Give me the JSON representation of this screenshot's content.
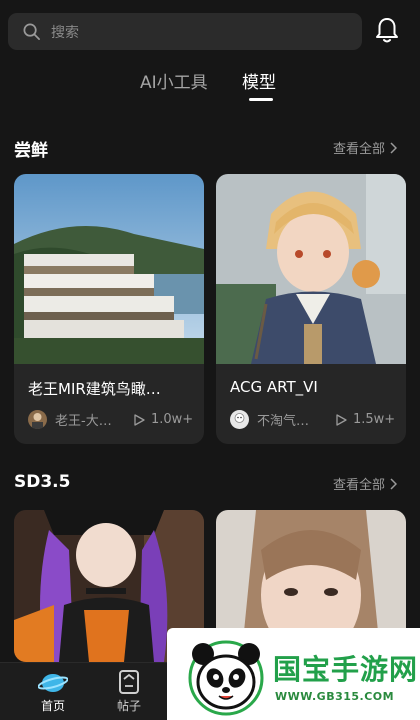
{
  "search": {
    "placeholder": "搜索"
  },
  "tabs": [
    {
      "label": "AI小工具",
      "active": false
    },
    {
      "label": "模型",
      "active": true
    }
  ],
  "sections": [
    {
      "title": "尝鲜",
      "see_all": "查看全部",
      "cards": [
        {
          "title": "老王MIR建筑鸟瞰…",
          "author": "老王-大…",
          "plays": "1.0w+"
        },
        {
          "title": "ACG ART_VI",
          "author": "不淘气…",
          "plays": "1.5w+"
        }
      ]
    },
    {
      "title": "SD3.5",
      "see_all": "查看全部",
      "cards": [
        {},
        {}
      ]
    }
  ],
  "bottom_nav": [
    {
      "label": "首页",
      "active": true
    },
    {
      "label": "帖子",
      "active": false
    }
  ],
  "watermark": {
    "title": "国宝手游网",
    "url": "WWW.GB315.COM"
  },
  "colors": {
    "background": "#161616",
    "card": "#262626",
    "accent": "#3fb6e8",
    "watermark_green": "#22a04a"
  }
}
